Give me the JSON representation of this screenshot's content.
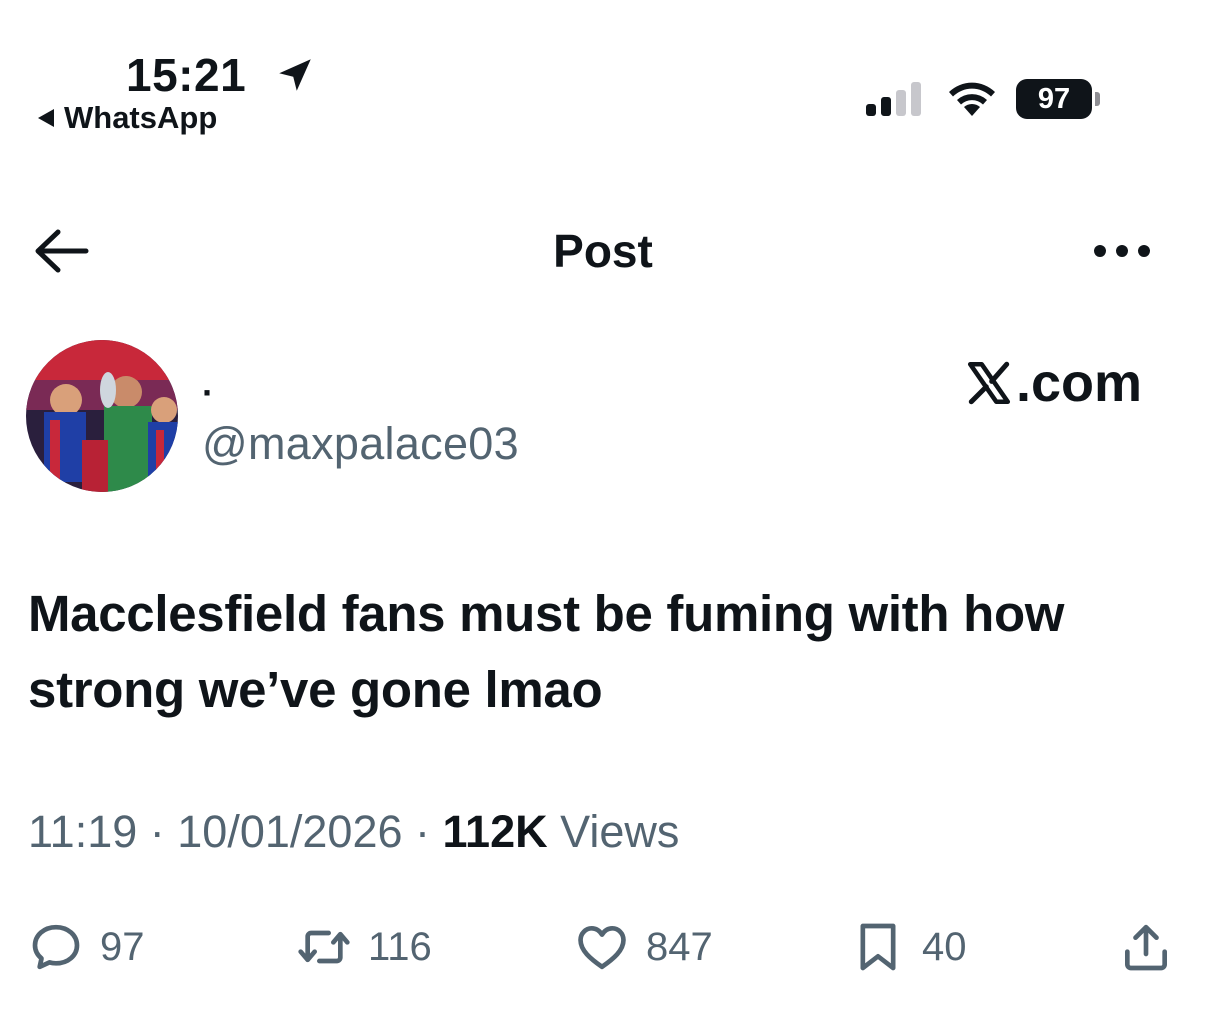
{
  "status_bar": {
    "time": "15:21",
    "back_app": "WhatsApp",
    "battery": "97"
  },
  "nav": {
    "title": "Post"
  },
  "author": {
    "display_name": "·",
    "handle": "@maxpalace03",
    "watermark": ".com"
  },
  "post": {
    "text": "Macclesfield fans must be fuming with how strong we’ve gone lmao",
    "time": "11:19",
    "date": "10/01/2026",
    "views_count": "112K",
    "views_label": "Views",
    "separator": " · "
  },
  "actions": {
    "replies": "97",
    "reposts": "116",
    "likes": "847",
    "bookmarks": "40"
  },
  "icons": [
    "location-arrow-icon",
    "back-arrow-icon",
    "more-icon",
    "x-logo-icon",
    "reply-icon",
    "repost-icon",
    "like-icon",
    "bookmark-icon",
    "share-icon"
  ],
  "colors": {
    "text": "#0f1419",
    "secondary": "#536471",
    "background": "#ffffff"
  }
}
